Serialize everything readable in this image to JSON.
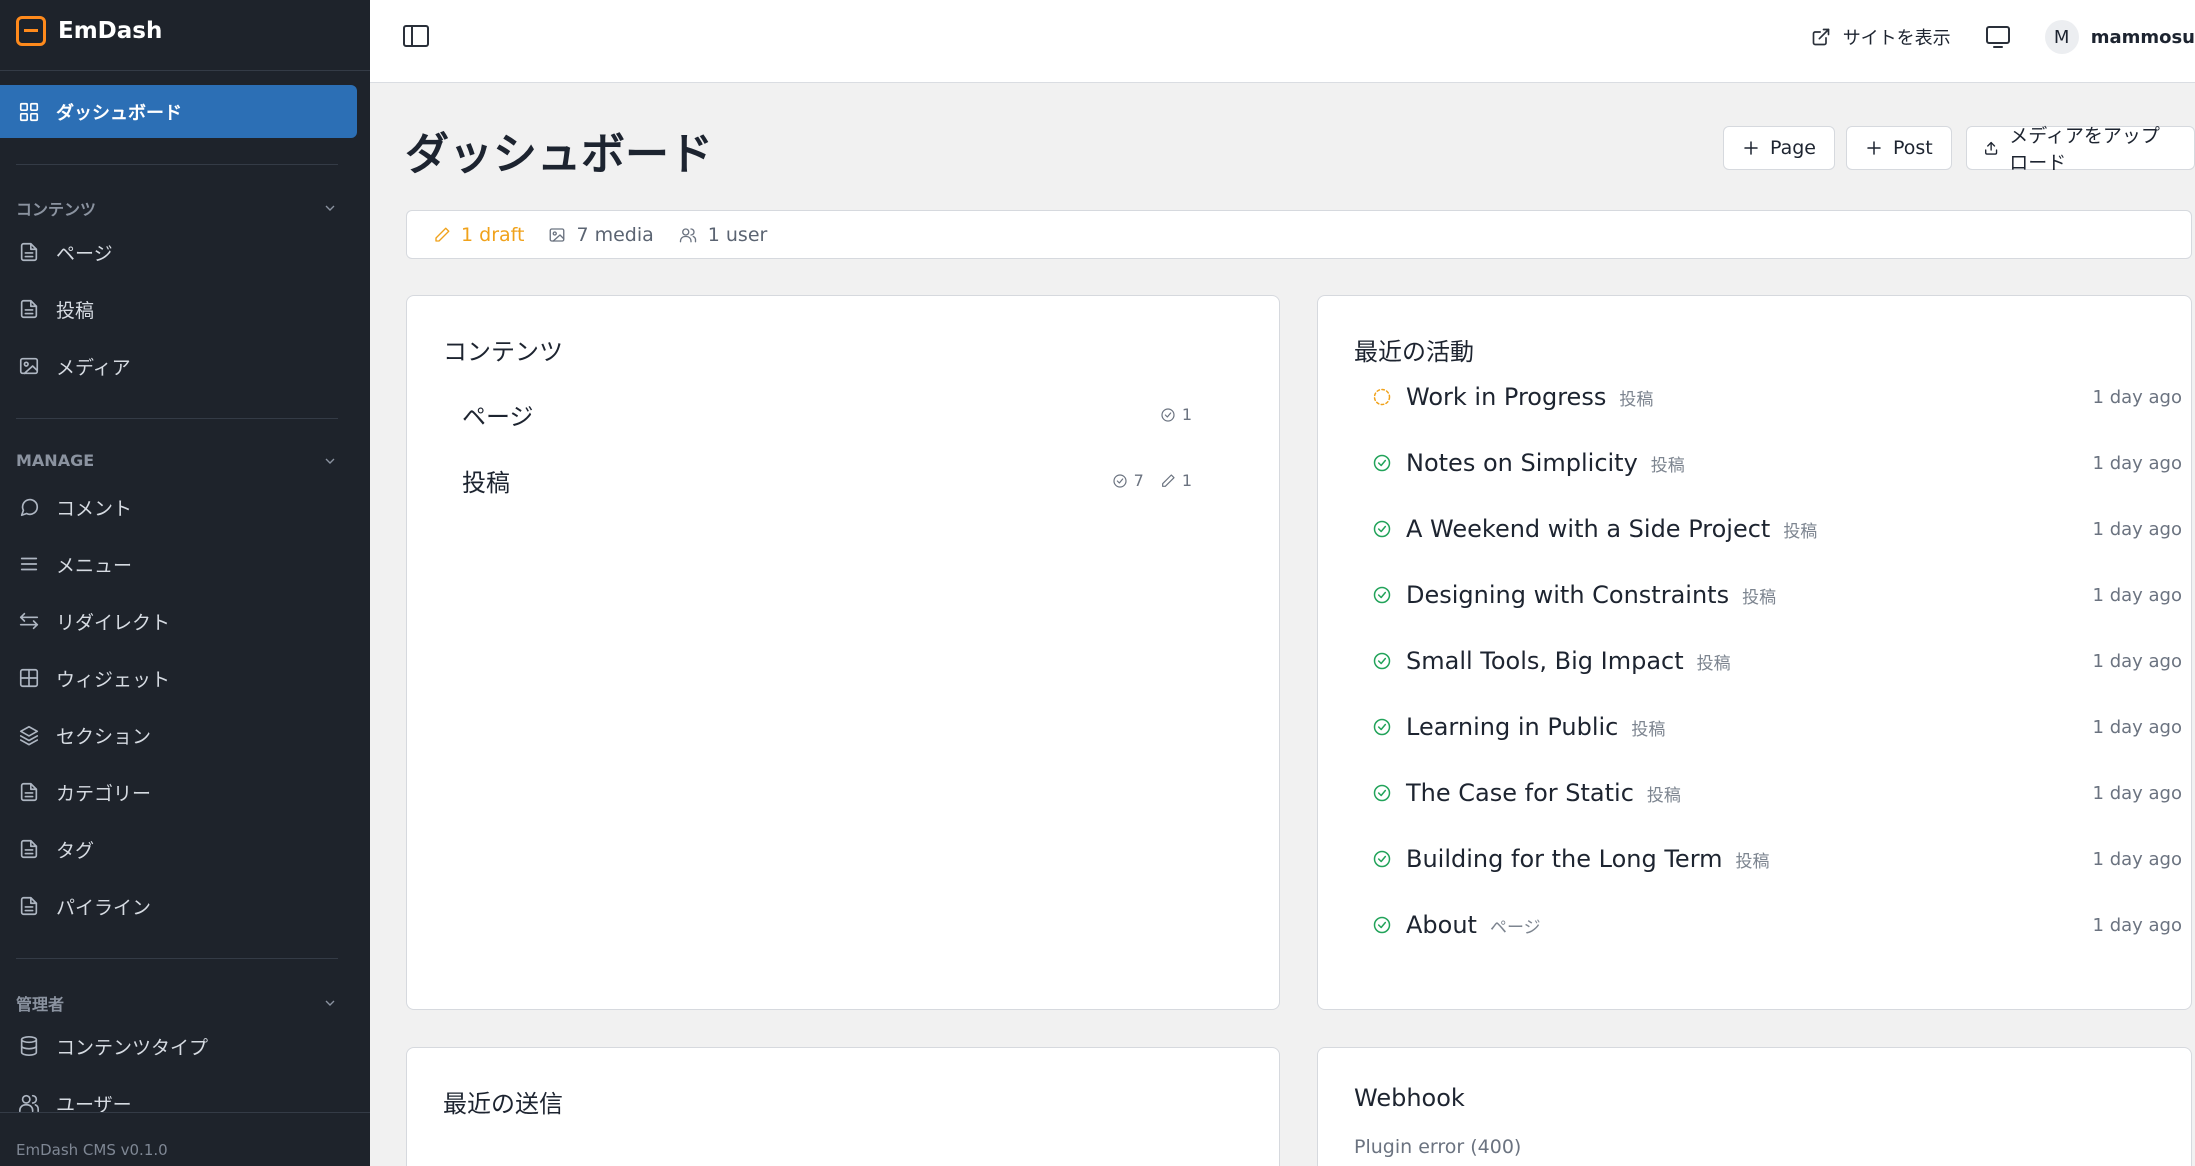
{
  "sidebar": {
    "brand": "EmDash",
    "active_item": "ダッシュボード",
    "sections": [
      {
        "title": "コンテンツ",
        "items": [
          "ページ",
          "投稿",
          "メディア"
        ]
      },
      {
        "title": "MANAGE",
        "items": [
          "コメント",
          "メニュー",
          "リダイレクト",
          "ウィジェット",
          "セクション",
          "カテゴリー",
          "タグ",
          "パイライン"
        ]
      },
      {
        "title": "管理者",
        "items": [
          "コンテンツタイプ",
          "ユーザー"
        ]
      }
    ],
    "footer": "EmDash CMS v0.1.0"
  },
  "topbar": {
    "view_site": "サイトを表示",
    "avatar_initial": "M",
    "user_name": "mammosu"
  },
  "main": {
    "title": "ダッシュボード",
    "actions": {
      "page": "Page",
      "post": "Post",
      "upload": "メディアをアップロード"
    },
    "stats": {
      "drafts": "1 draft",
      "media": "7 media",
      "users": "1 user"
    },
    "content_card": {
      "title": "コンテンツ",
      "rows": [
        {
          "label": "ページ",
          "published": "1",
          "drafts": ""
        },
        {
          "label": "投稿",
          "published": "7",
          "drafts": "1"
        }
      ]
    },
    "activity_card": {
      "title": "最近の活動",
      "items": [
        {
          "title": "Work in Progress",
          "type": "投稿",
          "time": "1 day ago",
          "status": "draft"
        },
        {
          "title": "Notes on Simplicity",
          "type": "投稿",
          "time": "1 day ago",
          "status": "published"
        },
        {
          "title": "A Weekend with a Side Project",
          "type": "投稿",
          "time": "1 day ago",
          "status": "published"
        },
        {
          "title": "Designing with Constraints",
          "type": "投稿",
          "time": "1 day ago",
          "status": "published"
        },
        {
          "title": "Small Tools, Big Impact",
          "type": "投稿",
          "time": "1 day ago",
          "status": "published"
        },
        {
          "title": "Learning in Public",
          "type": "投稿",
          "time": "1 day ago",
          "status": "published"
        },
        {
          "title": "The Case for Static",
          "type": "投稿",
          "time": "1 day ago",
          "status": "published"
        },
        {
          "title": "Building for the Long Term",
          "type": "投稿",
          "time": "1 day ago",
          "status": "published"
        },
        {
          "title": "About",
          "type": "ページ",
          "time": "1 day ago",
          "status": "published"
        }
      ]
    },
    "submissions_card": {
      "title": "最近の送信"
    },
    "webhook_card": {
      "title": "Webhook",
      "error": "Plugin error (400)"
    }
  },
  "colors": {
    "sidebar_bg": "#1e232b",
    "accent": "#2c6fb5",
    "brand": "#ff8a1c",
    "draft": "#f0a21b",
    "published": "#22a35a"
  }
}
